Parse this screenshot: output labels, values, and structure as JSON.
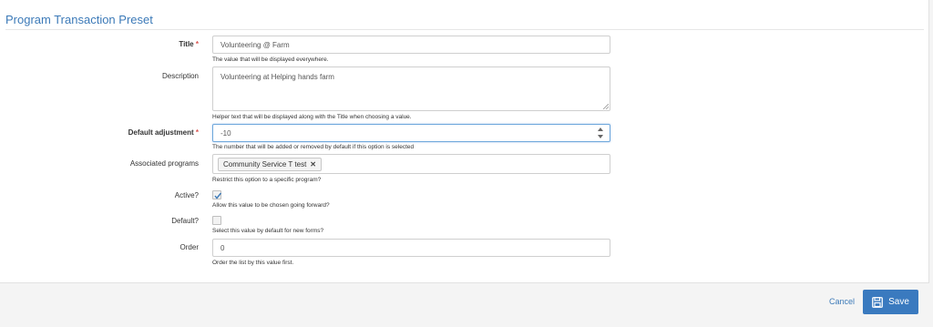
{
  "form": {
    "legend": "Program Transaction Preset",
    "required_mark": "*",
    "title": {
      "label": "Title",
      "value": "Volunteering @ Farm",
      "help": "The value that will be displayed everywhere."
    },
    "description": {
      "label": "Description",
      "value": "Volunteering at Helping hands farm",
      "help": "Helper text that will be displayed along with the Title when choosing a value."
    },
    "default_adjustment": {
      "label": "Default adjustment",
      "value": "-10",
      "help": "The number that will be added or removed by default if this option is selected"
    },
    "associated_programs": {
      "label": "Associated programs",
      "chips": [
        "Community Service T test"
      ],
      "remove_glyph": "✕",
      "help": "Restrict this option to a specific program?"
    },
    "active": {
      "label": "Active?",
      "checked": true,
      "help": "Allow this value to be chosen going forward?"
    },
    "default": {
      "label": "Default?",
      "checked": false,
      "help": "Select this value by default for new forms?"
    },
    "order": {
      "label": "Order",
      "value": "0",
      "help": "Order the list by this value first."
    }
  },
  "footer": {
    "cancel_label": "Cancel",
    "save_label": "Save",
    "save_icon": "floppy-disk-icon"
  },
  "colors": {
    "accent": "#3c7ab8",
    "save_button": "#3a7abf",
    "required": "#d9534f"
  }
}
